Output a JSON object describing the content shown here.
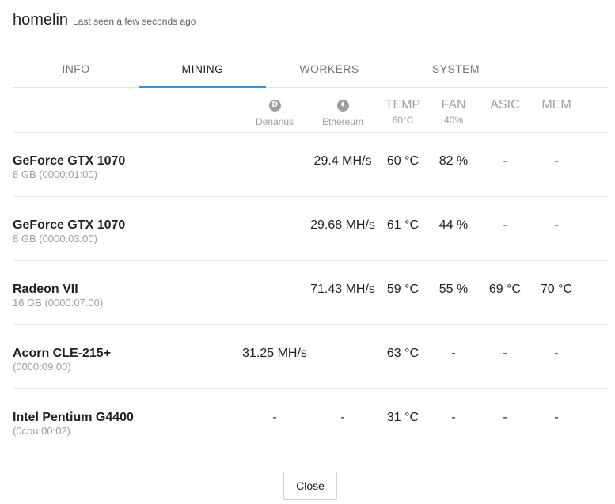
{
  "header": {
    "name": "homelin",
    "last_seen": "Last seen a few seconds ago"
  },
  "tabs": [
    {
      "label": "INFO",
      "active": false
    },
    {
      "label": "MINING",
      "active": true
    },
    {
      "label": "WORKERS",
      "active": false
    },
    {
      "label": "SYSTEM",
      "active": false
    }
  ],
  "columns": {
    "denarius": {
      "icon": "denarius-coin-icon",
      "glyph": "D",
      "label": "Denarius"
    },
    "ethereum": {
      "icon": "ethereum-coin-icon",
      "glyph": "♦",
      "label": "Ethereum"
    },
    "temp": {
      "label": "TEMP",
      "sub": "60°C"
    },
    "fan": {
      "label": "FAN",
      "sub": "40%"
    },
    "asic": {
      "label": "ASIC"
    },
    "mem": {
      "label": "MEM"
    }
  },
  "devices": [
    {
      "name": "GeForce GTX 1070",
      "detail": "8 GB (0000:01:00)",
      "denarius": "",
      "ethereum": "29.4 MH/s",
      "temp": "60 °C",
      "fan": "82 %",
      "asic": "-",
      "mem": "-"
    },
    {
      "name": "GeForce GTX 1070",
      "detail": "8 GB (0000:03:00)",
      "denarius": "",
      "ethereum": "29.68 MH/s",
      "temp": "61 °C",
      "fan": "44 %",
      "asic": "-",
      "mem": "-"
    },
    {
      "name": "Radeon VII",
      "detail": "16 GB (0000:07:00)",
      "denarius": "",
      "ethereum": "71.43 MH/s",
      "temp": "59 °C",
      "fan": "55 %",
      "asic": "69 °C",
      "mem": "70 °C"
    },
    {
      "name": "Acorn CLE-215+",
      "detail": "(0000:09:00)",
      "denarius": "31.25 MH/s",
      "ethereum": "",
      "temp": "63 °C",
      "fan": "-",
      "asic": "-",
      "mem": "-"
    },
    {
      "name": "Intel Pentium G4400",
      "detail": "(0cpu:00:02)",
      "denarius": "-",
      "ethereum": "-",
      "temp": "31 °C",
      "fan": "-",
      "asic": "-",
      "mem": "-"
    }
  ],
  "footer": {
    "close_label": "Close"
  }
}
